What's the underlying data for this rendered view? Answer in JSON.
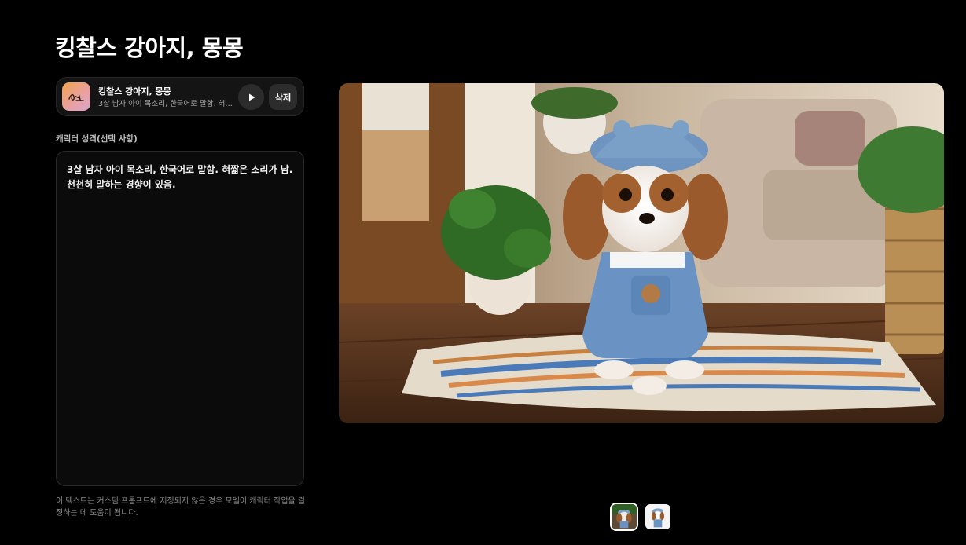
{
  "page": {
    "title": "킹찰스 강아지, 몽몽"
  },
  "voice": {
    "name": "킹찰스 강아지, 몽몽",
    "description": "3살 남자 아이 목소리, 한국어로 말함. 혀짧은 소리가 남. 천천히 말하는 경향이 있음.",
    "avatar_icon": "signature-logo-icon",
    "play_icon": "play-icon",
    "delete_label": "삭제"
  },
  "persona": {
    "label": "캐릭터 성격(선택 사항)",
    "text": "3살 남자 아이 목소리, 한국어로 말함. 혀짧은 소리가 남.\n천천히 말하는 경향이 있음.",
    "help": "이 텍스트는 커스텀 프롬프트에 지정되지 않은 경우 모델이 캐릭터 작업을 결정하는 데 도움이 됩니다."
  },
  "gallery": {
    "selected_index": 0,
    "thumbnail_count": 2
  },
  "colors": {
    "background": "#000000",
    "card": "#141414",
    "button": "#2c2c2c",
    "avatar_gradient_start": "#f0a24a",
    "avatar_gradient_end": "#d9a6c9"
  }
}
